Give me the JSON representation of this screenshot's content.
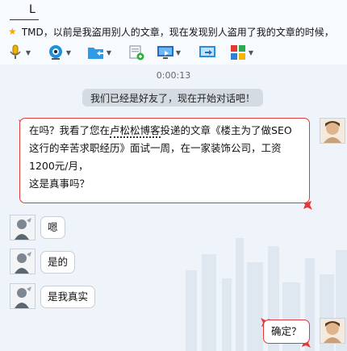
{
  "window": {
    "title": "L",
    "signature": "TMD，以前是我盗用别人的文章，现在发现别人盗用了我的文章的时候，"
  },
  "toolbar": {
    "items": [
      {
        "icon": "microphone-icon"
      },
      {
        "icon": "webcam-icon"
      },
      {
        "icon": "send-file-icon"
      },
      {
        "icon": "invite-icon"
      },
      {
        "icon": "remote-assist-icon"
      },
      {
        "icon": "share-screen-icon"
      },
      {
        "icon": "apps-icon"
      }
    ]
  },
  "chat": {
    "timestamp": "0:00:13",
    "notice": "我们已经是好友了，现在开始对话吧！",
    "messages": [
      {
        "sender": "self",
        "line1_pre": "在吗？我看了您在",
        "line1_emph": "卢松松博客",
        "line1_post": "投递的文章《楼主为了做SEO",
        "line2": "这行的辛苦求职经历》面试一周，在一家装饰公司，工资",
        "line3": "1200元/月，",
        "line4": "这是真事吗？"
      },
      {
        "sender": "other",
        "text": "嗯"
      },
      {
        "sender": "other",
        "text": "是的"
      },
      {
        "sender": "other",
        "text": "是我真实"
      },
      {
        "sender": "self",
        "text": "确定？"
      }
    ]
  },
  "colors": {
    "accent_red": "#e23a3a",
    "background": "#eef4fa",
    "notice_bg": "#d4dbe3"
  }
}
